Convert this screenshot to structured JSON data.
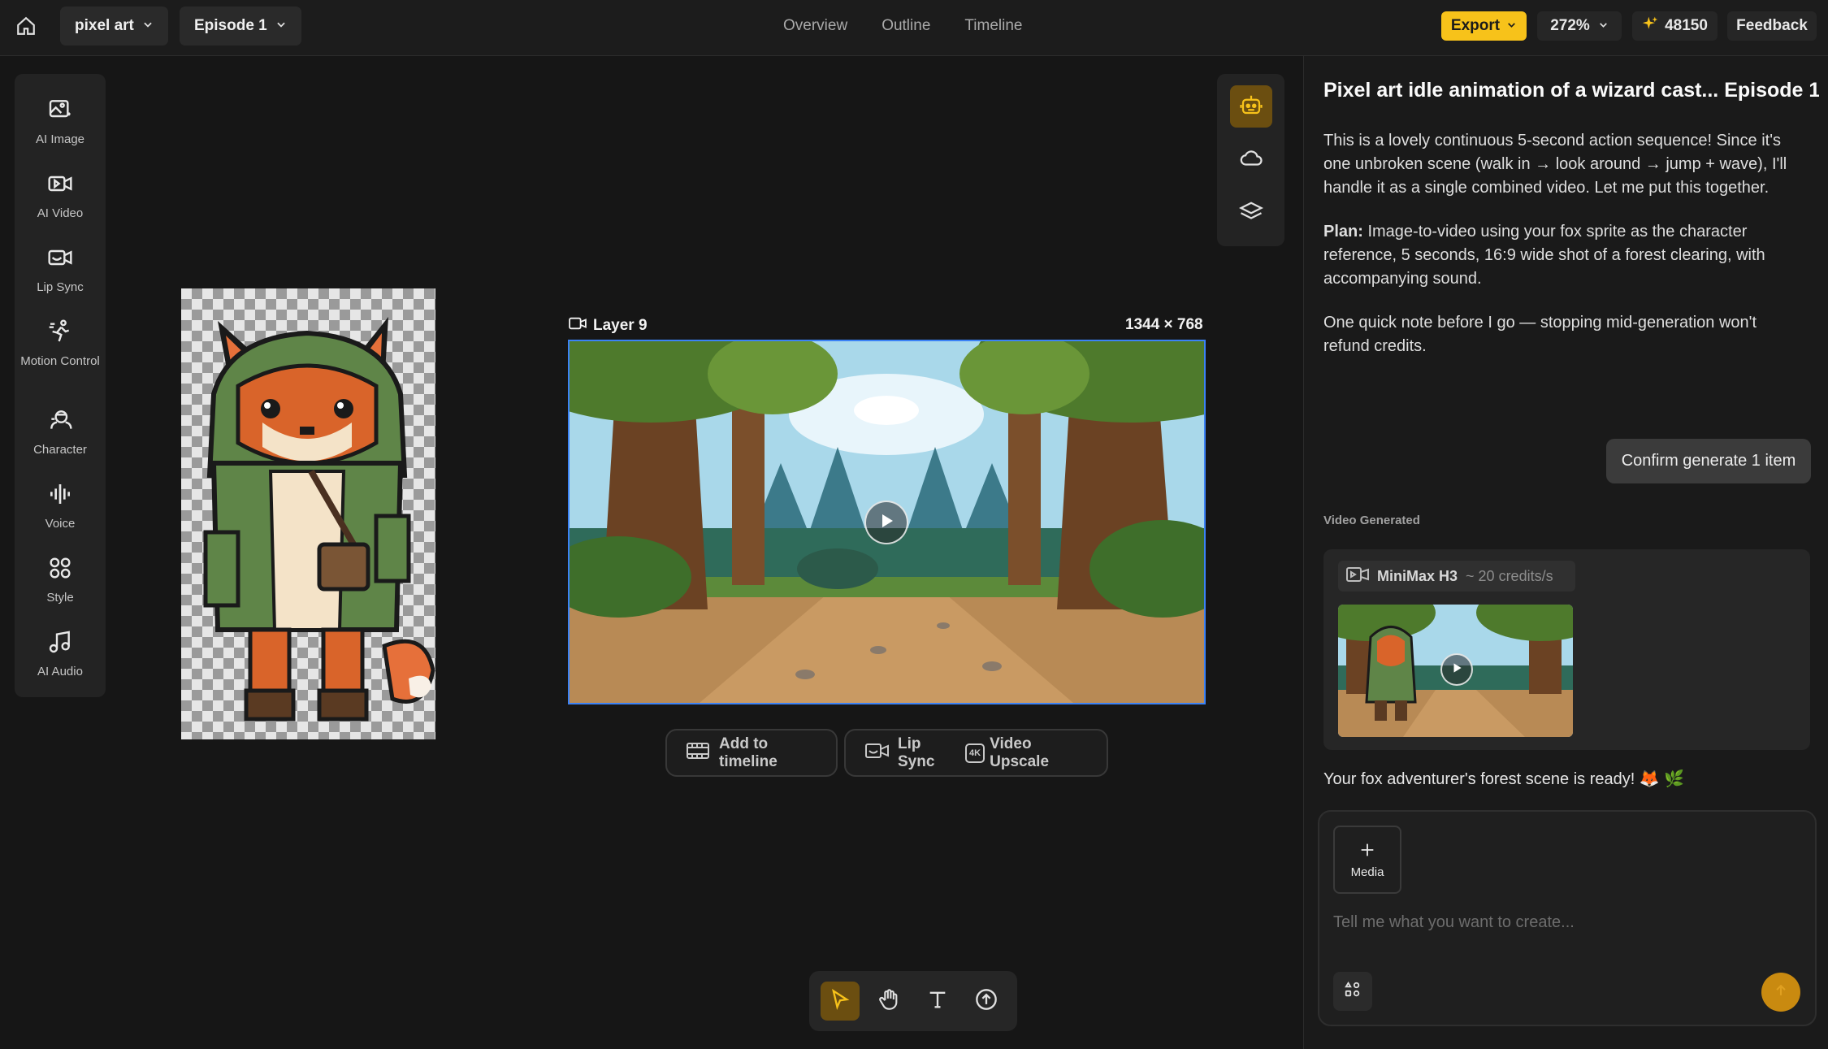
{
  "header": {
    "project": "pixel art",
    "episode": "Episode 1",
    "tabs": [
      "Overview",
      "Outline",
      "Timeline"
    ],
    "export_label": "Export",
    "zoom": "272%",
    "credits": "48150",
    "feedback_label": "Feedback"
  },
  "tools": [
    {
      "label": "AI Image",
      "icon": "image-icon"
    },
    {
      "label": "AI Video",
      "icon": "video-icon"
    },
    {
      "label": "Lip Sync",
      "icon": "lip-sync-icon"
    },
    {
      "label": "Motion Control",
      "icon": "motion-icon"
    },
    {
      "label": "Character",
      "icon": "character-icon"
    },
    {
      "label": "Voice",
      "icon": "voice-icon"
    },
    {
      "label": "Style",
      "icon": "style-icon"
    },
    {
      "label": "AI Audio",
      "icon": "audio-icon"
    }
  ],
  "canvas": {
    "layer_name": "Layer 9",
    "layer_dims": "1344 × 768",
    "add_to_timeline": "Add to timeline",
    "lip_sync": "Lip Sync",
    "video_upscale": "Video Upscale",
    "upscale_badge": "4K"
  },
  "chat": {
    "title": "Pixel art idle animation of a wizard cast...  Episode 1",
    "p1": "This is a lovely continuous 5-second action sequence! Since it's one unbroken scene (walk in → look around → jump + wave), I'll handle it as a single combined video. Let me put this together.",
    "p2_bold": "Plan:",
    "p2": " Image-to-video using your fox sprite as the character reference, 5 seconds, 16:9 wide shot of a forest clearing, with accompanying sound.",
    "p3": "One quick note before I go — stopping mid-generation won't refund credits.",
    "confirm_label": "Confirm generate 1 item",
    "section_label": "Video Generated",
    "model_name": "MiniMax H3",
    "model_cost": "~ 20 credits/s",
    "ready": "Your fox adventurer's forest scene is ready! 🦊 🌿",
    "media_label": "Media",
    "input_placeholder": "Tell me what you want to create..."
  },
  "colors": {
    "accent": "#f7c21a",
    "selection": "#3b82f6",
    "send": "#c98a10"
  }
}
